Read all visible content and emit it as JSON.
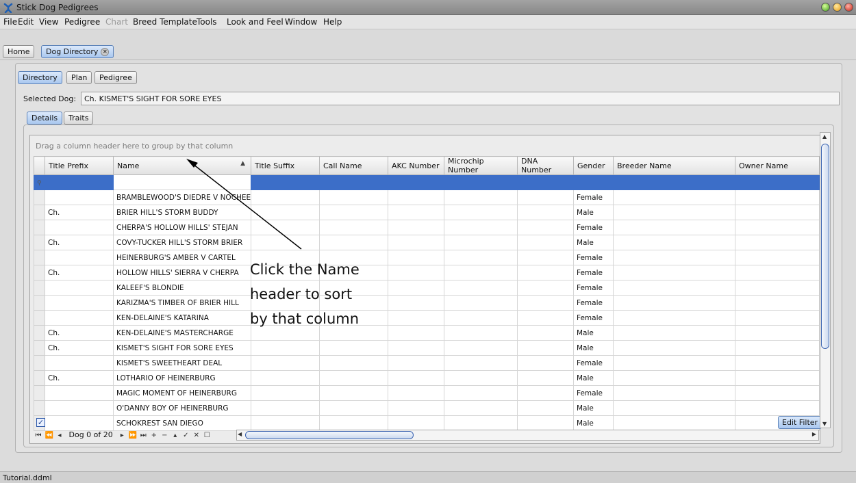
{
  "window": {
    "title": "Stick Dog Pedigrees",
    "icon": "stick-dog-icon"
  },
  "menu": [
    "File",
    "Edit",
    "View",
    "Pedigree",
    "Chart",
    "Breed Template",
    "Tools",
    "Look and Feel",
    "Window",
    "Help"
  ],
  "doc_tabs": [
    "Home",
    "Dog Directory"
  ],
  "sub_tabs": [
    "Directory",
    "Plan",
    "Pedigree"
  ],
  "selected_dog": {
    "label": "Selected Dog:",
    "value": "Ch. KISMET'S SIGHT FOR SORE EYES"
  },
  "detail_tabs": [
    "Details",
    "Traits"
  ],
  "grid": {
    "group_hint": "Drag a column header here to group by that column",
    "columns": [
      "Title Prefix",
      "Name",
      "Title Suffix",
      "Call Name",
      "AKC Number",
      "Microchip Number",
      "DNA Number",
      "Gender",
      "Breeder Name",
      "Owner Name"
    ],
    "sorted_column": "Name",
    "rows": [
      {
        "prefix": "",
        "name": "BRAMBLEWOOD'S DIEDRE V NOCHEE II",
        "gender": "Female"
      },
      {
        "prefix": "Ch.",
        "name": "BRIER HILL'S STORM BUDDY",
        "gender": "Male"
      },
      {
        "prefix": "",
        "name": "CHERPA'S HOLLOW HILLS' STEJAN",
        "gender": "Female"
      },
      {
        "prefix": "Ch.",
        "name": "COVY-TUCKER HILL'S STORM BRIER",
        "gender": "Male"
      },
      {
        "prefix": "",
        "name": "HEINERBURG'S AMBER V CARTEL",
        "gender": "Female"
      },
      {
        "prefix": "Ch.",
        "name": "HOLLOW HILLS' SIERRA V CHERPA",
        "gender": "Female"
      },
      {
        "prefix": "",
        "name": "KALEEF'S BLONDIE",
        "gender": "Female"
      },
      {
        "prefix": "",
        "name": "KARIZMA'S TIMBER OF BRIER HILL",
        "gender": "Female"
      },
      {
        "prefix": "",
        "name": "KEN-DELAINE'S KATARINA",
        "gender": "Female"
      },
      {
        "prefix": "Ch.",
        "name": "KEN-DELAINE'S MASTERCHARGE",
        "gender": "Male"
      },
      {
        "prefix": "Ch.",
        "name": "KISMET'S SIGHT FOR SORE EYES",
        "gender": "Male"
      },
      {
        "prefix": "",
        "name": "KISMET'S SWEETHEART DEAL",
        "gender": "Female"
      },
      {
        "prefix": "Ch.",
        "name": "LOTHARIO OF HEINERBURG",
        "gender": "Male"
      },
      {
        "prefix": "",
        "name": "MAGIC MOMENT OF HEINERBURG",
        "gender": "Female"
      },
      {
        "prefix": "",
        "name": "O'DANNY BOY OF HEINERBURG",
        "gender": "Male"
      },
      {
        "prefix": "",
        "name": "SCHOKREST SAN DIEGO",
        "gender": "Male"
      }
    ],
    "edit_filter_label": "Edit Filter",
    "navigator_text": "Dog 0 of 20"
  },
  "annotation": {
    "lines": [
      "Click the Name",
      "header to sort",
      "by that column"
    ]
  },
  "status": "Tutorial.ddml",
  "colors": {
    "selection_blue": "#3c6ec8",
    "accent_blue": "#a9c7ef"
  }
}
